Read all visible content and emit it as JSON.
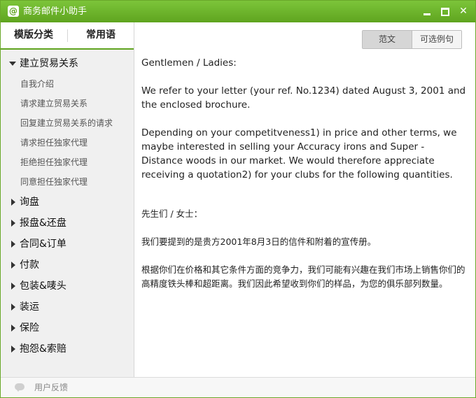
{
  "window": {
    "title": "商务邮件小助手",
    "icon_glyph": "@"
  },
  "tabs": [
    "模版分类",
    "常用语"
  ],
  "tree": {
    "expanded": {
      "label": "建立贸易关系",
      "children": [
        "自我介绍",
        "请求建立贸易关系",
        "回复建立贸易关系的请求",
        "请求担任独家代理",
        "拒绝担任独家代理",
        "同意担任独家代理"
      ]
    },
    "collapsed": [
      "询盘",
      "报盘&还盘",
      "合同&订单",
      "付款",
      "包装&唛头",
      "装运",
      "保险",
      "抱怨&索赔"
    ]
  },
  "toggle": {
    "sample": "范文",
    "optional": "可选例句"
  },
  "letter": {
    "en": [
      "Gentlemen / Ladies:",
      "We refer to your letter (your ref. No.1234) dated August 3, 2001 and the enclosed brochure.",
      "Depending on your competitveness1) in price and other terms, we maybe interested in selling your Accuracy irons and Super - Distance woods in our market. We would therefore appreciate receiving a quotation2) for your clubs for the following quantities."
    ],
    "cn": [
      "先生们 / 女士：",
      " 我们要提到的是贵方2001年8月3日的信件和附着的宣传册。",
      "根据你们在价格和其它条件方面的竞争力，我们可能有兴趣在我们市场上销售你们的高精度铁头棒和超距离。我们因此希望收到你们的样品，为您的俱乐部列数量。"
    ]
  },
  "footer": {
    "feedback": "用户反馈"
  },
  "colors": {
    "titlebar": "#6db52c",
    "accent": "#5fa41f"
  }
}
